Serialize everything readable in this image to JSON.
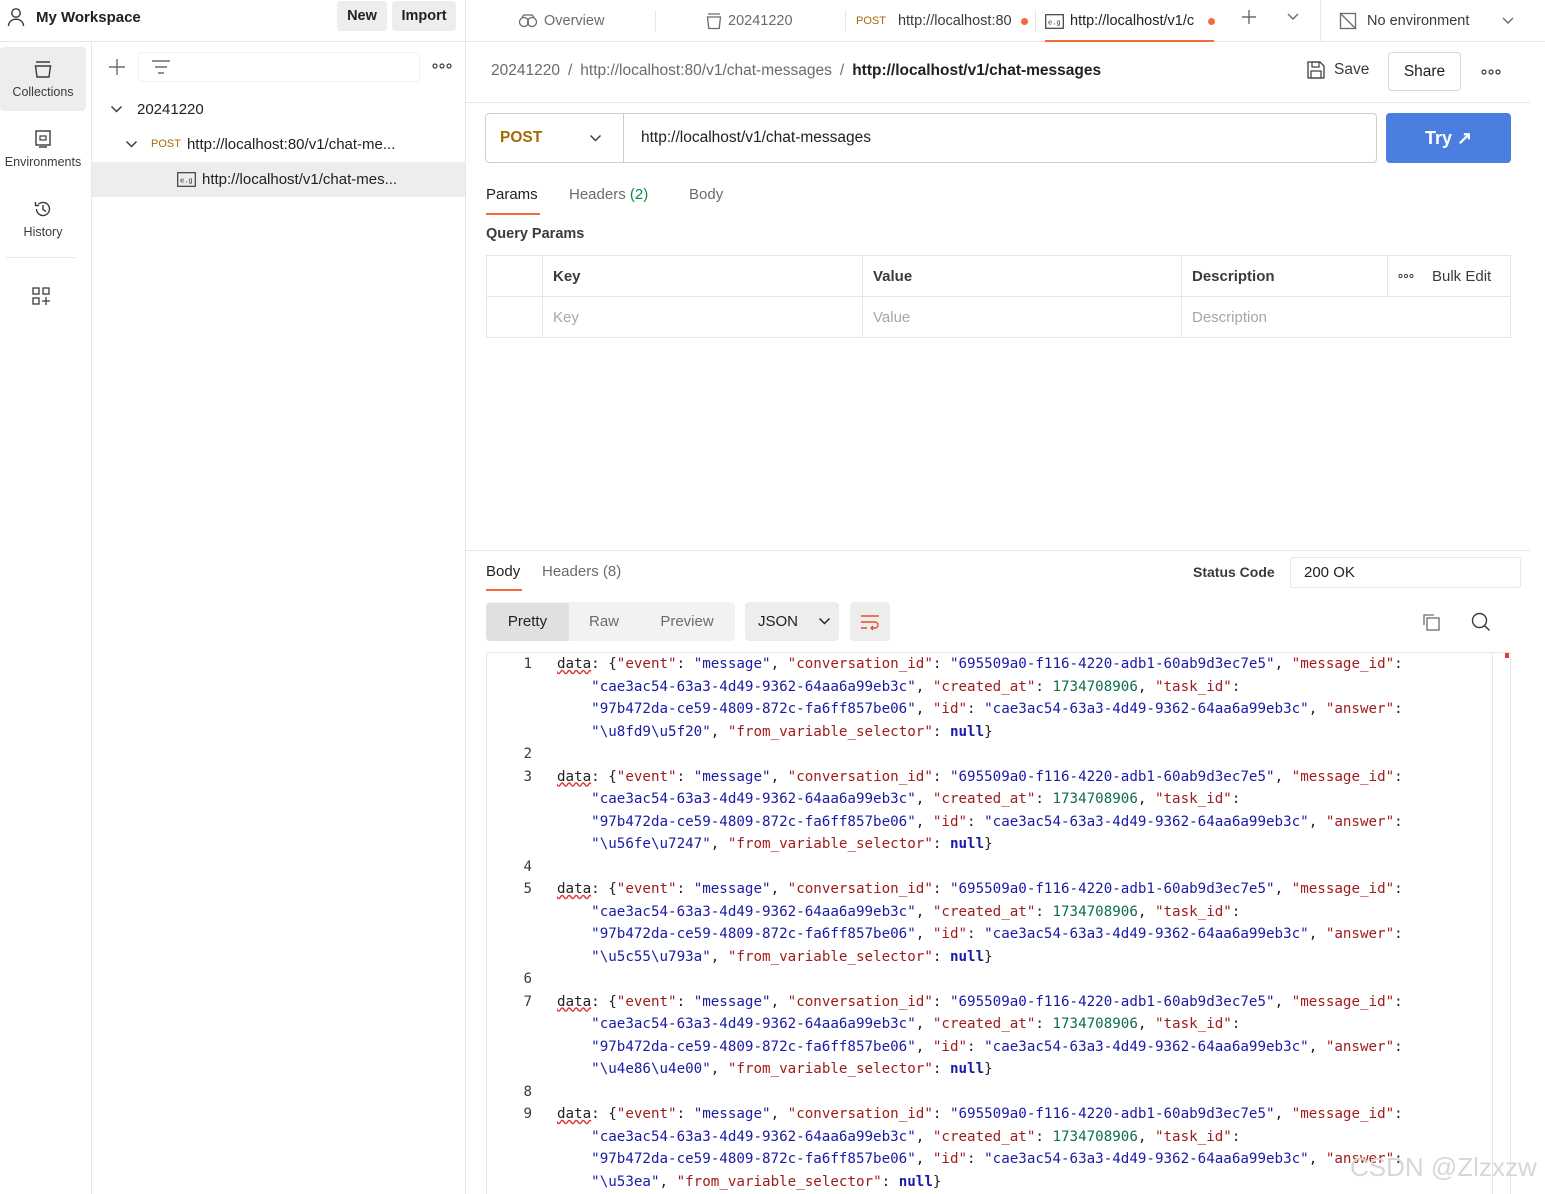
{
  "workspace": {
    "title": "My Workspace",
    "new_label": "New",
    "import_label": "Import"
  },
  "tabs": [
    {
      "label": "Overview"
    },
    {
      "label": "20241220"
    },
    {
      "method": "POST",
      "label": "http://localhost:80"
    },
    {
      "label": "http://localhost/v1/c"
    }
  ],
  "environment": {
    "label": "No environment"
  },
  "rail": {
    "collections": "Collections",
    "environments": "Environments",
    "history": "History"
  },
  "tree": {
    "collection": "20241220",
    "request_method": "POST",
    "request": "http://localhost:80/v1/chat-me...",
    "example": "http://localhost/v1/chat-mes..."
  },
  "breadcrumb": {
    "part1": "20241220",
    "part2": "http://localhost:80/v1/chat-messages",
    "current": "http://localhost/v1/chat-messages",
    "sep": "/"
  },
  "header_actions": {
    "save": "Save",
    "share": "Share"
  },
  "request": {
    "method": "POST",
    "url": "http://localhost/v1/chat-messages",
    "try_label": "Try ↗"
  },
  "request_tabs": {
    "params": "Params",
    "headers": "Headers",
    "headers_count": "(2)",
    "body": "Body"
  },
  "query_params": {
    "title": "Query Params",
    "columns": {
      "key": "Key",
      "value": "Value",
      "description": "Description",
      "bulk_edit": "Bulk Edit"
    },
    "placeholders": {
      "key": "Key",
      "value": "Value",
      "description": "Description"
    }
  },
  "response": {
    "tabs": {
      "body": "Body",
      "headers": "Headers",
      "headers_count": "(8)"
    },
    "status_label": "Status Code",
    "status_value": "200 OK",
    "views": {
      "pretty": "Pretty",
      "raw": "Raw",
      "preview": "Preview"
    },
    "format": "JSON",
    "lines": [
      {
        "no": "1",
        "wrap": [
          "data: {\"event\": \"message\", \"conversation_id\": \"695509a0-f116-4220-adb1-60ab9d3ec7e5\", \"message_id\":",
          "    \"cae3ac54-63a3-4d49-9362-64aa6a99eb3c\", \"created_at\": 1734708906, \"task_id\":",
          "    \"97b472da-ce59-4809-872c-fa6ff857be06\", \"id\": \"cae3ac54-63a3-4d49-9362-64aa6a99eb3c\", \"answer\":",
          "    \"\\u8fd9\\u5f20\", \"from_variable_selector\": null}"
        ]
      },
      {
        "no": "2",
        "wrap": [
          ""
        ]
      },
      {
        "no": "3",
        "wrap": [
          "data: {\"event\": \"message\", \"conversation_id\": \"695509a0-f116-4220-adb1-60ab9d3ec7e5\", \"message_id\":",
          "    \"cae3ac54-63a3-4d49-9362-64aa6a99eb3c\", \"created_at\": 1734708906, \"task_id\":",
          "    \"97b472da-ce59-4809-872c-fa6ff857be06\", \"id\": \"cae3ac54-63a3-4d49-9362-64aa6a99eb3c\", \"answer\":",
          "    \"\\u56fe\\u7247\", \"from_variable_selector\": null}"
        ]
      },
      {
        "no": "4",
        "wrap": [
          ""
        ]
      },
      {
        "no": "5",
        "wrap": [
          "data: {\"event\": \"message\", \"conversation_id\": \"695509a0-f116-4220-adb1-60ab9d3ec7e5\", \"message_id\":",
          "    \"cae3ac54-63a3-4d49-9362-64aa6a99eb3c\", \"created_at\": 1734708906, \"task_id\":",
          "    \"97b472da-ce59-4809-872c-fa6ff857be06\", \"id\": \"cae3ac54-63a3-4d49-9362-64aa6a99eb3c\", \"answer\":",
          "    \"\\u5c55\\u793a\", \"from_variable_selector\": null}"
        ]
      },
      {
        "no": "6",
        "wrap": [
          ""
        ]
      },
      {
        "no": "7",
        "wrap": [
          "data: {\"event\": \"message\", \"conversation_id\": \"695509a0-f116-4220-adb1-60ab9d3ec7e5\", \"message_id\":",
          "    \"cae3ac54-63a3-4d49-9362-64aa6a99eb3c\", \"created_at\": 1734708906, \"task_id\":",
          "    \"97b472da-ce59-4809-872c-fa6ff857be06\", \"id\": \"cae3ac54-63a3-4d49-9362-64aa6a99eb3c\", \"answer\":",
          "    \"\\u4e86\\u4e00\", \"from_variable_selector\": null}"
        ]
      },
      {
        "no": "8",
        "wrap": [
          ""
        ]
      },
      {
        "no": "9",
        "wrap": [
          "data: {\"event\": \"message\", \"conversation_id\": \"695509a0-f116-4220-adb1-60ab9d3ec7e5\", \"message_id\":",
          "    \"cae3ac54-63a3-4d49-9362-64aa6a99eb3c\", \"created_at\": 1734708906, \"task_id\":",
          "    \"97b472da-ce59-4809-872c-fa6ff857be06\", \"id\": \"cae3ac54-63a3-4d49-9362-64aa6a99eb3c\", \"answer\":",
          "    \"\\u53ea\", \"from_variable_selector\": null}"
        ]
      }
    ]
  },
  "watermark": "CSDN @Zlzxzw",
  "colors": {
    "accent": "#f26b3a",
    "primary": "#4a7fe0",
    "method_post": "#a36b00"
  },
  "icons": [
    "user-icon",
    "overview-icon",
    "collection-icon",
    "example-icon",
    "plus-icon",
    "chevron-down-icon",
    "no-environment-icon",
    "environments-icon",
    "history-icon",
    "add-apps-icon",
    "filter-icon",
    "more-icon",
    "save-icon",
    "wrap-icon",
    "copy-icon",
    "search-icon"
  ]
}
